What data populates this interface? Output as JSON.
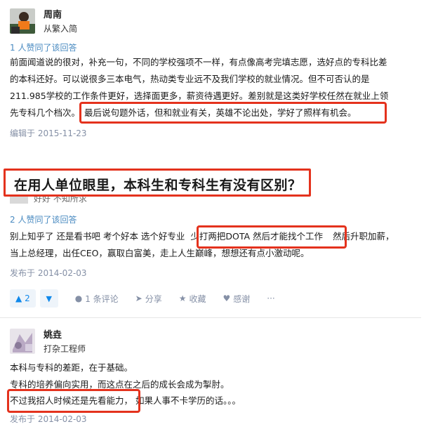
{
  "answer1": {
    "author": "周南",
    "bio": "从繁入简",
    "votes": "1 人赞同了该回答",
    "lines": [
      "前面闻道说的很对，补充一句，不同的学校强项不一样，有点像高考完填志愿，选好点的专科比差",
      "的本科还好。可以说很多三本电气，热动类专业远不及我们学校的就业情况。但不可否认的是",
      "211.985学校的工作条件更好，选择面更多，薪资待遇更好。差别就是这类好学校任然在就业上领"
    ],
    "line4_prefix": "先专科几个档次。",
    "line4_highlight": "最后说句题外话，但和就业有关，英雄不论出处，学好了照样有机会。",
    "edited": "编辑于 2015-11-23"
  },
  "question": {
    "title": "在用人单位眼里，本科生和专科生有没有区别？"
  },
  "answer2": {
    "partial_author": "好好 不知所求",
    "votes": "2 人赞同了该回答",
    "line1_prefix": "别上知乎了 还是看书吧 考个好本 选个好专业",
    "line1_highlight": "少打两把DOTA 然后才能找个工作",
    "line1_suffix": "然后升职加薪，",
    "line2": "当上总经理，出任CEO，赢取白富美，走上人生巅峰，想想还有点小激动呢。",
    "published": "发布于 2014-02-03",
    "toolbar": {
      "upvote_count": "2",
      "comments": "1 条评论",
      "share": "分享",
      "collect": "收藏",
      "thanks": "感谢",
      "more": "···"
    }
  },
  "answer3": {
    "author": "姚垚",
    "bio": "打杂工程师",
    "line1": "本科与专科的差距，在于基础。",
    "line2": "专科的培养偏向实用，而这点在之后的成长会成为掣肘。",
    "line3_highlight": "不过我招人时候还是先看能力，",
    "line3_suffix": "如果人事不卡学历的话。。。",
    "published": "发布于 2014-02-03"
  },
  "colors": {
    "highlight_border": "#e4321d",
    "link_blue": "#0f88eb",
    "meta_gray": "#8590a6"
  }
}
